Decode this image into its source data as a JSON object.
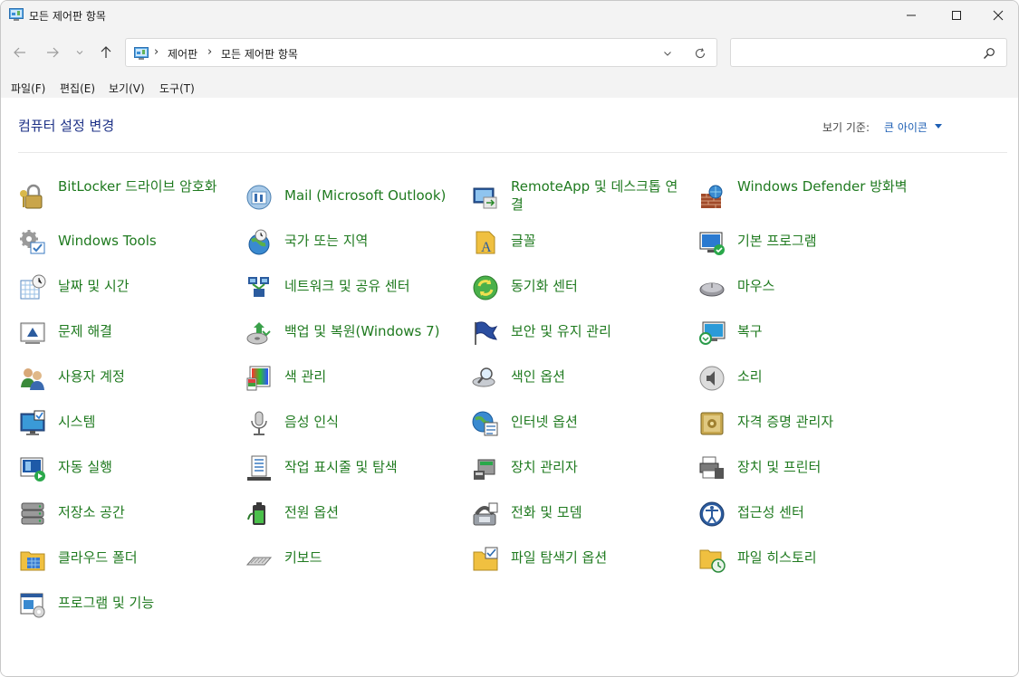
{
  "window": {
    "title": "모든 제어판 항목"
  },
  "address": {
    "crumbs": [
      "제어판",
      "모든 제어판 항목"
    ]
  },
  "search": {
    "placeholder": ""
  },
  "menu": [
    "파일(F)",
    "편집(E)",
    "보기(V)",
    "도구(T)"
  ],
  "header": {
    "title": "컴퓨터 설정 변경",
    "viewby_label": "보기 기준:",
    "viewby_value": "큰 아이콘"
  },
  "items": [
    {
      "label": "BitLocker 드라이브 암호화",
      "icon": "bitlocker-icon"
    },
    {
      "label": "Mail (Microsoft Outlook)",
      "icon": "mail-icon"
    },
    {
      "label": "RemoteApp 및 데스크톱 연결",
      "icon": "remoteapp-icon"
    },
    {
      "label": "Windows Defender 방화벽",
      "icon": "firewall-icon"
    },
    {
      "label": "Windows Tools",
      "icon": "tools-icon"
    },
    {
      "label": "국가 또는 지역",
      "icon": "region-icon"
    },
    {
      "label": "글꼴",
      "icon": "fonts-icon"
    },
    {
      "label": "기본 프로그램",
      "icon": "default-programs-icon"
    },
    {
      "label": "날짜 및 시간",
      "icon": "datetime-icon"
    },
    {
      "label": "네트워크 및 공유 센터",
      "icon": "network-icon"
    },
    {
      "label": "동기화 센터",
      "icon": "sync-icon"
    },
    {
      "label": "마우스",
      "icon": "mouse-icon"
    },
    {
      "label": "문제 해결",
      "icon": "troubleshoot-icon"
    },
    {
      "label": "백업 및 복원(Windows 7)",
      "icon": "backup-icon"
    },
    {
      "label": "보안 및 유지 관리",
      "icon": "security-flag-icon"
    },
    {
      "label": "복구",
      "icon": "recovery-icon"
    },
    {
      "label": "사용자 계정",
      "icon": "user-accounts-icon"
    },
    {
      "label": "색 관리",
      "icon": "color-management-icon"
    },
    {
      "label": "색인 옵션",
      "icon": "indexing-icon"
    },
    {
      "label": "소리",
      "icon": "sound-icon"
    },
    {
      "label": "시스템",
      "icon": "system-icon"
    },
    {
      "label": "음성 인식",
      "icon": "microphone-icon"
    },
    {
      "label": "인터넷 옵션",
      "icon": "internet-options-icon"
    },
    {
      "label": "자격 증명 관리자",
      "icon": "credential-icon"
    },
    {
      "label": "자동 실행",
      "icon": "autoplay-icon"
    },
    {
      "label": "작업 표시줄 및 탐색",
      "icon": "taskbar-icon"
    },
    {
      "label": "장치 관리자",
      "icon": "device-manager-icon"
    },
    {
      "label": "장치 및 프린터",
      "icon": "printer-icon"
    },
    {
      "label": "저장소 공간",
      "icon": "storage-icon"
    },
    {
      "label": "전원 옵션",
      "icon": "power-icon"
    },
    {
      "label": "전화 및 모뎀",
      "icon": "phone-modem-icon"
    },
    {
      "label": "접근성 센터",
      "icon": "accessibility-icon"
    },
    {
      "label": "클라우드 폴더",
      "icon": "cloud-folder-icon"
    },
    {
      "label": "키보드",
      "icon": "keyboard-icon"
    },
    {
      "label": "파일 탐색기 옵션",
      "icon": "explorer-options-icon"
    },
    {
      "label": "파일 히스토리",
      "icon": "file-history-icon"
    },
    {
      "label": "프로그램 및 기능",
      "icon": "programs-features-icon"
    }
  ]
}
